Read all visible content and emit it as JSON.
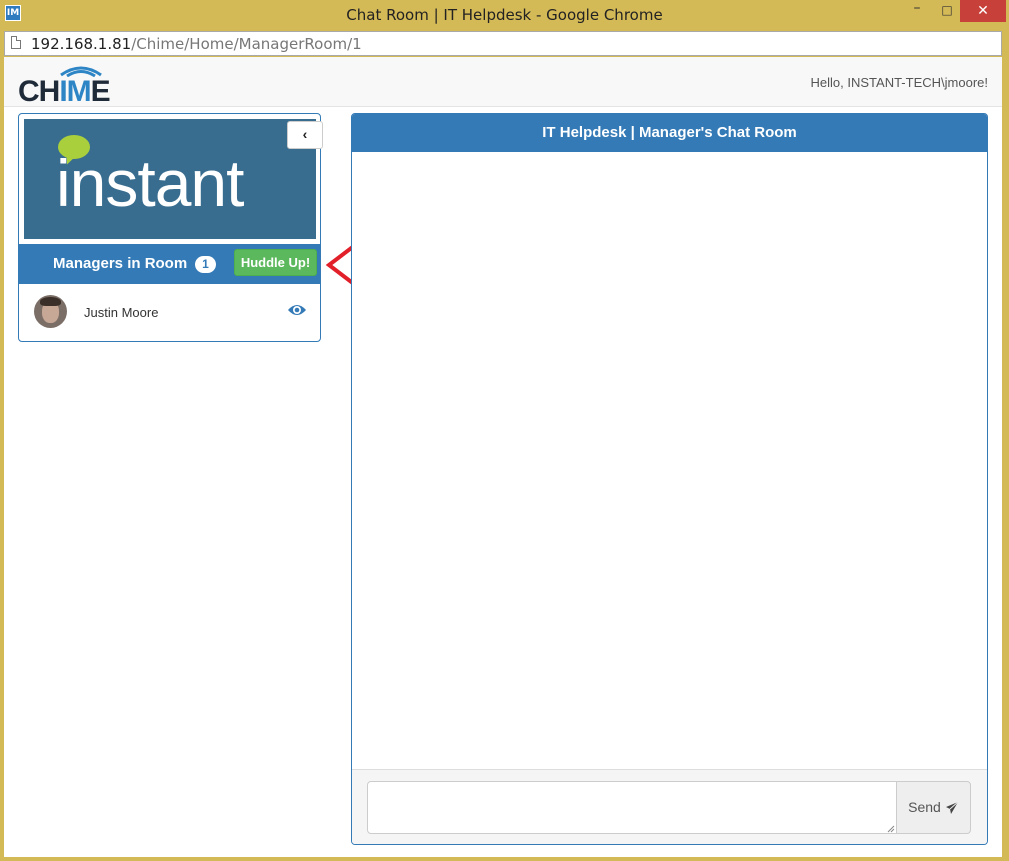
{
  "window": {
    "title": "Chat Room | IT Helpdesk - Google Chrome",
    "app_icon": "IM",
    "controls": {
      "minimize": "–",
      "maximize": "□",
      "close": "✕"
    }
  },
  "address_bar": {
    "host": "192.168.1.81",
    "path": "/Chime/Home/ManagerRoom/1"
  },
  "navbar": {
    "logo": {
      "part1": "CH",
      "part2": "IM",
      "part3": "E"
    },
    "greeting": "Hello, INSTANT-TECH\\jmoore!"
  },
  "sidebar": {
    "banner_text": "instant",
    "collapse_icon": "chevron-left-icon",
    "collapse_glyph": "‹",
    "header": {
      "title": "Managers in Room",
      "count": "1",
      "huddle_label": "Huddle Up!"
    },
    "managers": [
      {
        "name": "Justin Moore",
        "action_icon": "eye-icon"
      }
    ]
  },
  "chat": {
    "title": "IT Helpdesk | Manager's Chat Room",
    "input_value": "",
    "send_label": "Send",
    "send_icon": "paper-plane-icon"
  },
  "colors": {
    "primary": "#337ab7",
    "success": "#5cb85c",
    "banner": "#386d8f",
    "annotation_arrow": "#e2202a",
    "window_frame": "#d4b957"
  }
}
